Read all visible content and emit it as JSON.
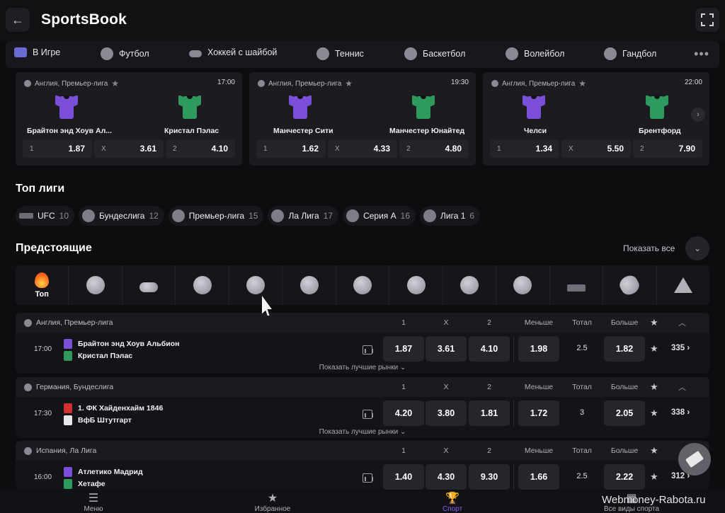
{
  "header": {
    "title": "SportsBook"
  },
  "sportnav": [
    {
      "label": "В Игре",
      "icon": "live-icon",
      "live": true
    },
    {
      "label": "Футбол",
      "icon": "football-icon"
    },
    {
      "label": "Хоккей с шайбой",
      "icon": "hockey-icon"
    },
    {
      "label": "Теннис",
      "icon": "tennis-icon"
    },
    {
      "label": "Баскетбол",
      "icon": "basketball-icon"
    },
    {
      "label": "Волейбол",
      "icon": "volleyball-icon"
    },
    {
      "label": "Гандбол",
      "icon": "handball-icon"
    }
  ],
  "featured": [
    {
      "league": "Англия, Премьер-лига",
      "time": "17:00",
      "home": "Брайтон энд Хоув Ал...",
      "away": "Кристал Пэлас",
      "homeColor": "#7b4fd8",
      "awayColor": "#2f9a5e",
      "o1": "1.87",
      "ox": "3.61",
      "o2": "4.10",
      "k1": "1",
      "kx": "X",
      "k2": "2"
    },
    {
      "league": "Англия, Премьер-лига",
      "time": "19:30",
      "home": "Манчестер Сити",
      "away": "Манчестер Юнайтед",
      "homeColor": "#7b4fd8",
      "awayColor": "#2f9a5e",
      "o1": "1.62",
      "ox": "4.33",
      "o2": "4.80",
      "k1": "1",
      "kx": "X",
      "k2": "2"
    },
    {
      "league": "Англия, Премьер-лига",
      "time": "22:00",
      "home": "Челси",
      "away": "Брентфорд",
      "homeColor": "#7b4fd8",
      "awayColor": "#2f9a5e",
      "o1": "1.34",
      "ox": "5.50",
      "o2": "7.90",
      "k1": "1",
      "kx": "X",
      "k2": "2"
    }
  ],
  "topLeagues": {
    "title": "Топ лиги",
    "items": [
      {
        "name": "UFC",
        "count": "10",
        "icon": "mma-icon"
      },
      {
        "name": "Бундеслига",
        "count": "12",
        "icon": "football-icon"
      },
      {
        "name": "Премьер-лига",
        "count": "15",
        "icon": "football-icon"
      },
      {
        "name": "Ла Лига",
        "count": "17",
        "icon": "football-icon"
      },
      {
        "name": "Серия А",
        "count": "16",
        "icon": "football-icon"
      },
      {
        "name": "Лига 1",
        "count": "6",
        "icon": "football-icon"
      }
    ]
  },
  "upcoming": {
    "title": "Предстоящие",
    "showAll": "Показать все",
    "topTab": "Топ",
    "headers": {
      "c1": "1",
      "cx": "X",
      "c2": "2",
      "under": "Меньше",
      "total": "Тотал",
      "over": "Больше"
    },
    "bestMarkets": "Показать лучшие рынки",
    "events": [
      {
        "league": "Англия, Премьер-лига",
        "time": "17:00",
        "home": "Брайтон энд Хоув Альбион",
        "away": "Кристал Пэлас",
        "homeKit": "#7b4fd8",
        "awayKit": "#2f9a5e",
        "o1": "1.87",
        "ox": "3.61",
        "o2": "4.10",
        "under": "1.98",
        "total": "2.5",
        "over": "1.82",
        "more": "335 ›"
      },
      {
        "league": "Германия, Бундеслига",
        "time": "17:30",
        "home": "1. ФК Хайденхайм 1846",
        "away": "ВфБ Штутгарт",
        "homeKit": "#d23030",
        "awayKit": "#e8e8e8",
        "o1": "4.20",
        "ox": "3.80",
        "o2": "1.81",
        "under": "1.72",
        "total": "3",
        "over": "2.05",
        "more": "338 ›"
      },
      {
        "league": "Испания, Ла Лига",
        "time": "16:00",
        "home": "Атлетико Мадрид",
        "away": "Хетафе",
        "homeKit": "#7b4fd8",
        "awayKit": "#2f9a5e",
        "o1": "1.40",
        "ox": "4.30",
        "o2": "9.30",
        "under": "1.66",
        "total": "2.5",
        "over": "2.22",
        "more": "312 ›"
      }
    ]
  },
  "bottomnav": [
    {
      "label": "Меню",
      "glyph": "☰"
    },
    {
      "label": "Избранное",
      "glyph": "★"
    },
    {
      "label": "Спорт",
      "glyph": "🏆",
      "active": true
    },
    {
      "label": "Все виды спорта",
      "glyph": "▦"
    }
  ],
  "watermark": "Webmoney-Rabota.ru",
  "colors": {
    "accent": "#8b5cf6",
    "background": "#0d0d10"
  }
}
